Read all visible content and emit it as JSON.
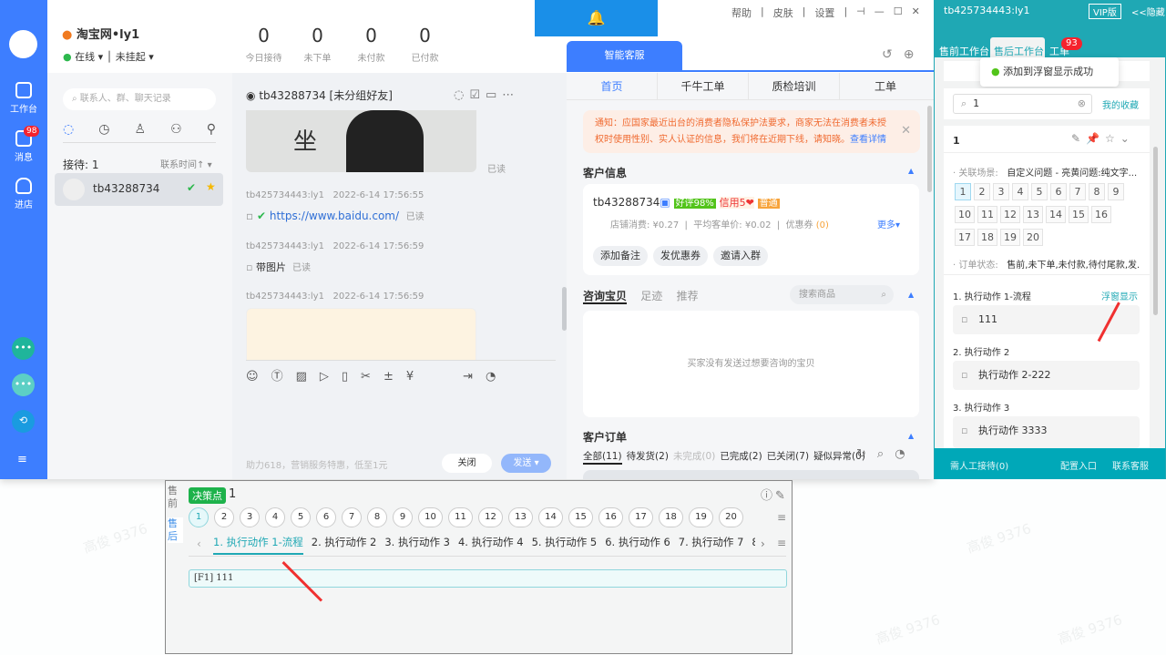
{
  "watermark": "高俊 9376",
  "nav": {
    "items": [
      {
        "label": "工作台",
        "icon": "workbench-icon"
      },
      {
        "label": "消息",
        "icon": "mail-icon",
        "badge": "98"
      },
      {
        "label": "进店",
        "icon": "store-icon"
      }
    ],
    "bottom_icons": [
      "chat-bot-icon",
      "chat-bot-alt-icon",
      "plugin-icon",
      "menu-icon"
    ]
  },
  "header": {
    "shop": "淘宝网•ly1",
    "status": "在线",
    "hangup": "未挂起",
    "stats": [
      {
        "value": "0",
        "label": "今日接待"
      },
      {
        "value": "0",
        "label": "未下单"
      },
      {
        "value": "0",
        "label": "未付款"
      },
      {
        "value": "0",
        "label": "已付款"
      }
    ],
    "menu": [
      "帮助",
      "皮肤",
      "设置"
    ]
  },
  "contacts": {
    "search_placeholder": "联系人、群、聊天记录",
    "reception": "接待: 1",
    "sort": "联系时间↑",
    "list": [
      {
        "name": "tb43288734"
      }
    ]
  },
  "chat": {
    "title": "tb43288734 [未分组好友]",
    "image_char": "坐",
    "read": "已读",
    "messages": [
      {
        "sender": "tb425734443:ly1",
        "time": "2022-6-14 17:56:55",
        "text": "https://www.baidu.com/",
        "read": "已读"
      },
      {
        "sender": "tb425734443:ly1",
        "time": "2022-6-14 17:56:59",
        "text": "带图片",
        "read": "已读"
      },
      {
        "sender": "tb425734443:ly1",
        "time": "2022-6-14 17:56:59"
      }
    ],
    "promo": "助力618，营销服务特惠，低至1元",
    "close": "关闭",
    "send": "发送"
  },
  "right": {
    "tab": "智能客服",
    "subtabs": [
      "首页",
      "千牛工单",
      "质检培训",
      "工单"
    ],
    "notice": "通知：应国家最近出台的消费者隐私保护法要求，商家无法在消费者未授权时使用性别、实人认证的信息，我们将在近期下线，请知晓。",
    "notice_link": "查看详情",
    "customer_title": "客户信息",
    "customer": {
      "id": "tb43288734",
      "rating": "好评98%",
      "credit": "信用5",
      "level": "普通",
      "spend": "店铺消费: ¥0.27",
      "avg": "平均客单价: ¥0.02",
      "coupon": "优惠券",
      "coupon_count": "(0)",
      "more": "更多"
    },
    "actions": [
      "添加备注",
      "发优惠券",
      "邀请入群"
    ],
    "goods_tabs": [
      "咨询宝贝",
      "足迹",
      "推荐"
    ],
    "goods_search": "搜索商品",
    "goods_empty": "买家没有发送过想要咨询的宝贝",
    "orders_title": "客户订单",
    "order_tabs": [
      "全部(11)",
      "待发货(2)",
      "未完成(0)",
      "已完成(2)",
      "已关闭(7)",
      "疑似异常(0)"
    ]
  },
  "teal": {
    "account": "tb425734443:ly1",
    "vip": "VIP版",
    "hide": "<<隐藏",
    "tabs": [
      "售前工作台",
      "售后工作台",
      "工单"
    ],
    "tab_badge": "93",
    "toast": "添加到浮窗显示成功",
    "search_value": "1",
    "favorites": "我的收藏",
    "item_title": "1",
    "scene_label": "· 关联场景:",
    "scene": "自定义问题 - 亮黄问题:纯文字...",
    "numbers": [
      "1",
      "2",
      "3",
      "4",
      "5",
      "6",
      "7",
      "8",
      "9",
      "10",
      "11",
      "12",
      "13",
      "14",
      "15",
      "16",
      "17",
      "18",
      "19",
      "20"
    ],
    "order_label": "· 订单状态:",
    "order_status": "售前,未下单,未付款,待付尾款,发...",
    "float_link": "浮窗显示",
    "actions": [
      {
        "title": "1. 执行动作 1-流程",
        "content": "111"
      },
      {
        "title": "2. 执行动作 2",
        "content": "执行动作 2-222"
      },
      {
        "title": "3. 执行动作 3",
        "content": "执行动作 3333"
      }
    ],
    "footer": [
      "需人工接待(0)",
      "配置入口",
      "联系客服"
    ]
  },
  "float": {
    "side": [
      "售前",
      "售后"
    ],
    "tag": "决策点",
    "title": "1",
    "numbers": [
      "1",
      "2",
      "3",
      "4",
      "5",
      "6",
      "7",
      "8",
      "9",
      "10",
      "11",
      "12",
      "13",
      "14",
      "15",
      "16",
      "17",
      "18",
      "19",
      "20"
    ],
    "tabs": [
      "1. 执行动作 1-流程",
      "2. 执行动作 2",
      "3. 执行动作 3",
      "4. 执行动作 4",
      "5. 执行动作 5",
      "6. 执行动作 6",
      "7. 执行动作 7",
      "8."
    ],
    "content": "[F1] 111"
  }
}
